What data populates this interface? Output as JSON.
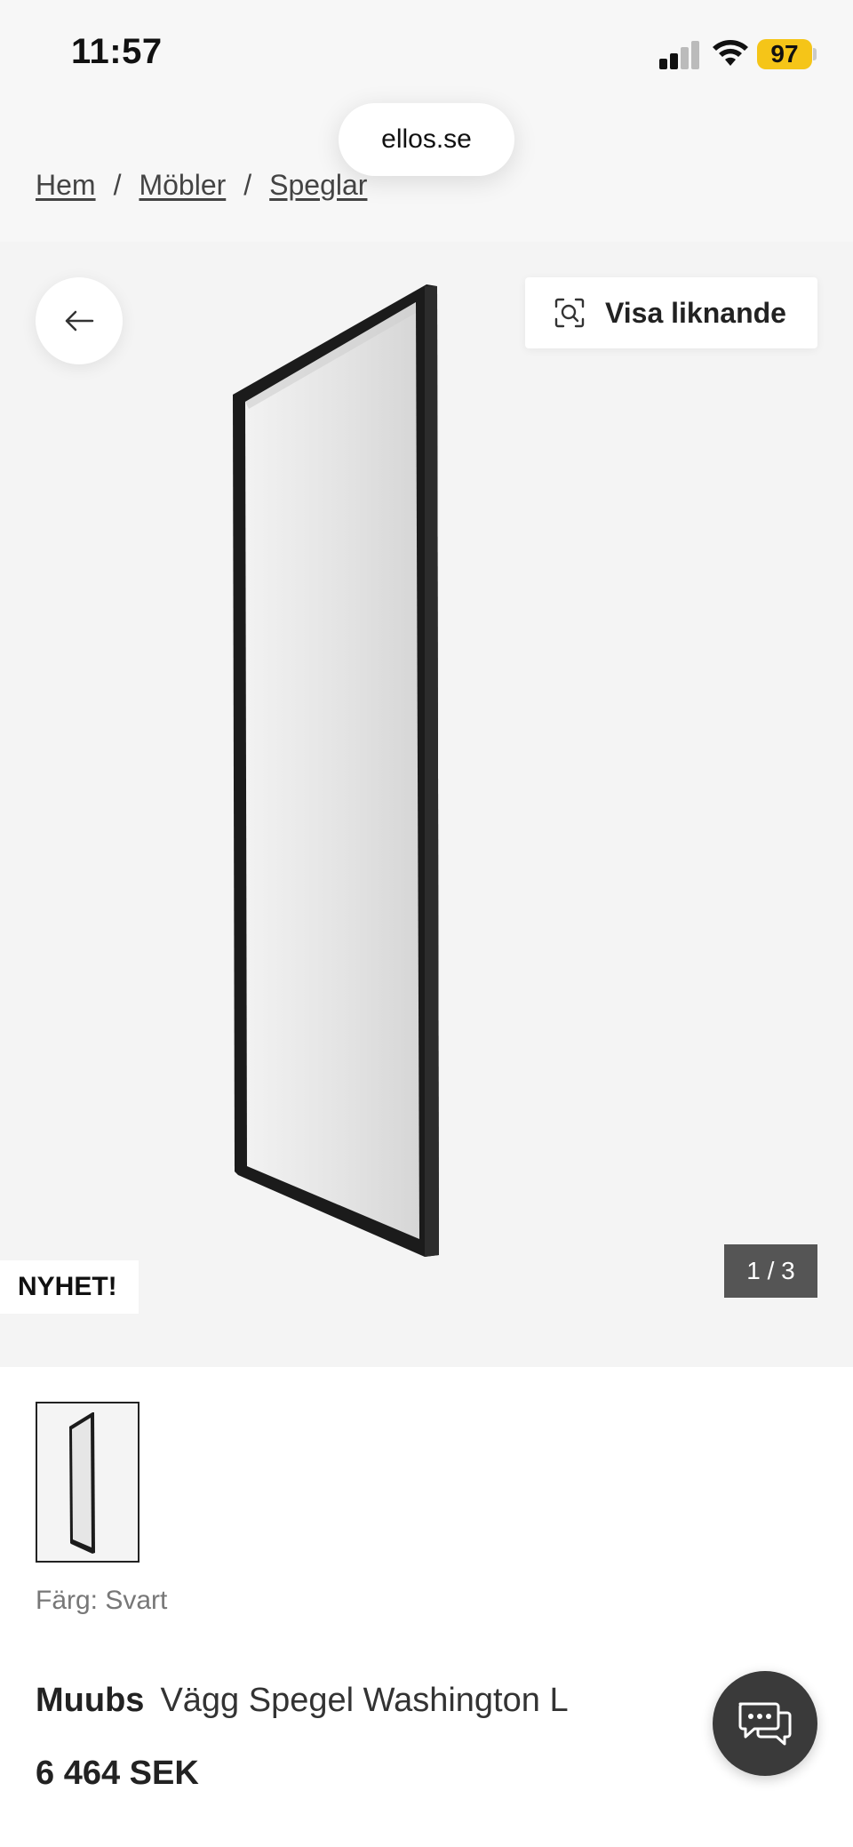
{
  "status_bar": {
    "time": "11:57",
    "battery_level": "97",
    "battery_color": "#f5c518"
  },
  "browser": {
    "url": "ellos.se"
  },
  "breadcrumb": {
    "items": [
      "Hem",
      "Möbler",
      "Speglar"
    ],
    "separator": "/"
  },
  "gallery": {
    "back_icon": "arrow-left-icon",
    "similar_button_label": "Visa liknande",
    "similar_icon": "visual-search-icon",
    "badge": "NYHET!",
    "counter": "1 / 3"
  },
  "product": {
    "color_label": "Färg: Svart",
    "brand": "Muubs",
    "name": "Vägg Spegel Washington L",
    "price": "6 464 SEK"
  },
  "chat": {
    "icon": "chat-bubbles-icon"
  }
}
